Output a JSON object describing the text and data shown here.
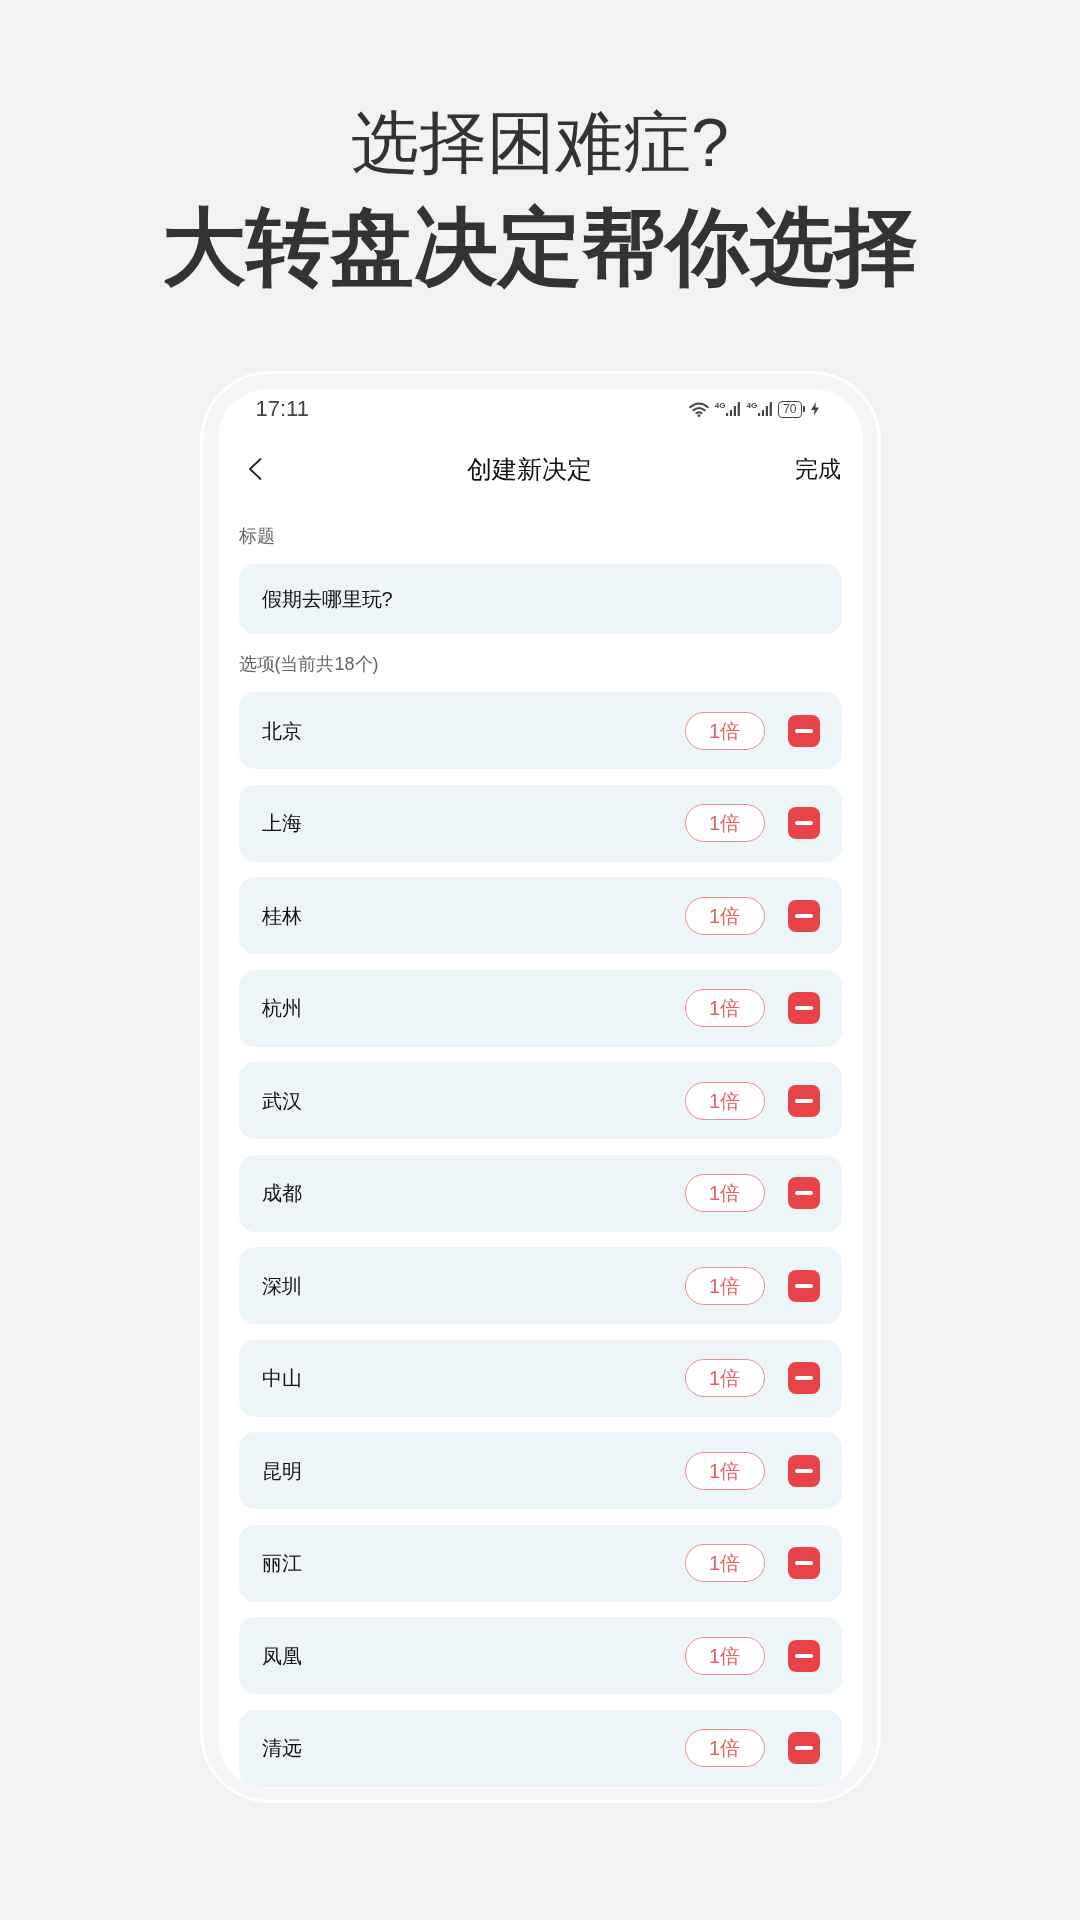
{
  "headline": {
    "question": "选择困难症?",
    "tagline": "大转盘决定帮你选择"
  },
  "status_bar": {
    "time": "17:11",
    "signals": [
      {
        "network": "4G"
      },
      {
        "network": "4G"
      }
    ],
    "battery": "70",
    "charging": true
  },
  "nav": {
    "title": "创建新决定",
    "action": "完成"
  },
  "title_field": {
    "label": "标题",
    "value": "假期去哪里玩?"
  },
  "options": {
    "label": "选项(当前共18个)",
    "items": [
      {
        "name": "北京",
        "weight": "1倍"
      },
      {
        "name": "上海",
        "weight": "1倍"
      },
      {
        "name": "桂林",
        "weight": "1倍"
      },
      {
        "name": "杭州",
        "weight": "1倍"
      },
      {
        "name": "武汉",
        "weight": "1倍"
      },
      {
        "name": "成都",
        "weight": "1倍"
      },
      {
        "name": "深圳",
        "weight": "1倍"
      },
      {
        "name": "中山",
        "weight": "1倍"
      },
      {
        "name": "昆明",
        "weight": "1倍"
      },
      {
        "name": "丽江",
        "weight": "1倍"
      },
      {
        "name": "凤凰",
        "weight": "1倍"
      },
      {
        "name": "清远",
        "weight": "1倍"
      }
    ]
  }
}
